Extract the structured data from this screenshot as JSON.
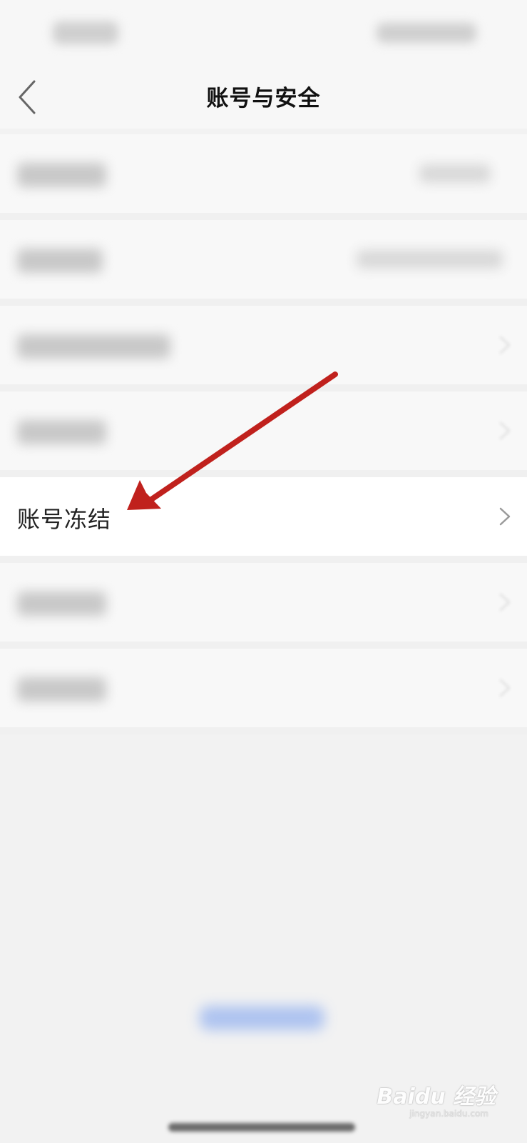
{
  "header": {
    "title": "账号与安全",
    "back_icon": "chevron-left-icon"
  },
  "list": {
    "highlighted_item": {
      "label": "账号冻结",
      "chevron_icon": "chevron-right-icon"
    }
  },
  "annotation": {
    "arrow_color": "#c0211d"
  },
  "watermark": {
    "brand": "Baidu 经验",
    "url": "jingyan.baidu.com"
  },
  "colors": {
    "background": "#f2f2f2",
    "row_background": "#ffffff",
    "link_blue": "#3b6fe0"
  }
}
